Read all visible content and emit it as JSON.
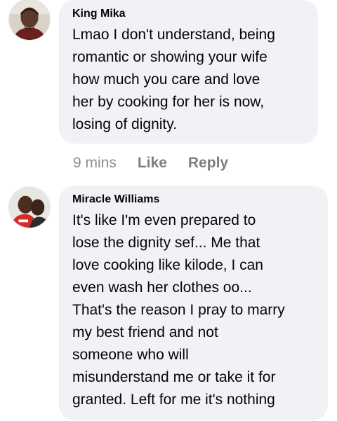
{
  "comments": [
    {
      "author": "King Mika",
      "lines": [
        "Lmao I don't understand, being",
        "romantic or showing your wife",
        "how much you care and love",
        "her by cooking for her is now,",
        "losing of dignity."
      ],
      "time": "9 mins",
      "like_label": "Like",
      "reply_label": "Reply"
    },
    {
      "author": "Miracle Williams",
      "lines": [
        "It's like I'm even prepared to",
        "lose the dignity sef... Me that",
        "love cooking like kilode, I can",
        "even wash her clothes oo...",
        "That's the reason I pray to marry",
        "my best friend and not",
        "someone who will",
        "misunderstand me or take it for",
        "granted. Left for me it's nothing"
      ]
    }
  ],
  "colors": {
    "bubble_bg": "#f0f2f5",
    "text": "#050505",
    "meta": "#8a8d91"
  }
}
